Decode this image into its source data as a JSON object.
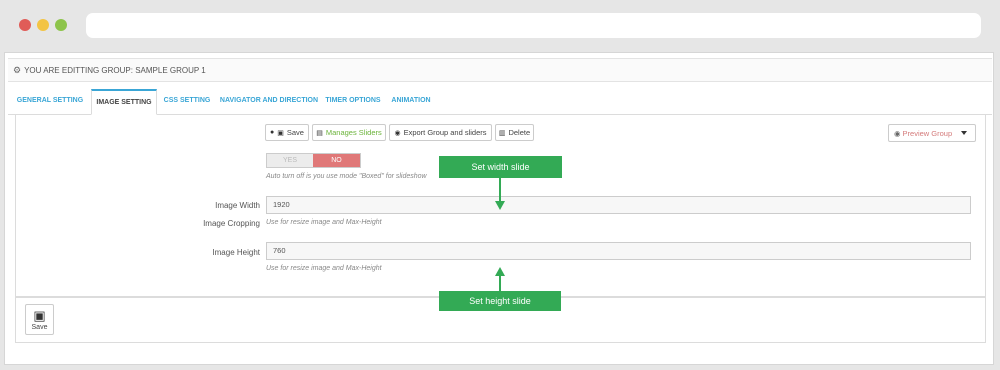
{
  "group_header": {
    "title": "YOU ARE EDITTING GROUP: SAMPLE GROUP 1"
  },
  "tabs": [
    {
      "label": "GENERAL SETTING"
    },
    {
      "label": "IMAGE SETTING"
    },
    {
      "label": "CSS SETTING"
    },
    {
      "label": "NAVIGATOR AND DIRECTION"
    },
    {
      "label": "TIMER OPTIONS"
    },
    {
      "label": "ANIMATION"
    }
  ],
  "toolbar": {
    "save": "Save",
    "manage_sliders": "Manages Sliders",
    "export": "Export Group and sliders",
    "delete": "Delete",
    "preview": "Preview Group"
  },
  "fields": {
    "cropping": {
      "label": "Image Cropping",
      "yes": "YES",
      "no": "NO",
      "help": "Auto turn off is you use mode \"Boxed\" for slideshow"
    },
    "width": {
      "label": "Image Width",
      "value": "1920",
      "help": "Use for resize image and Max-Height"
    },
    "height": {
      "label": "Image Height",
      "value": "760",
      "help": "Use for resize image and Max-Height"
    }
  },
  "footer": {
    "save": "Save"
  },
  "annotations": {
    "width": "Set width slide",
    "height": "Set height slide"
  },
  "colors": {
    "accent": "#3aa6d6",
    "callout": "#33aa55",
    "no_switch": "#e07878"
  }
}
